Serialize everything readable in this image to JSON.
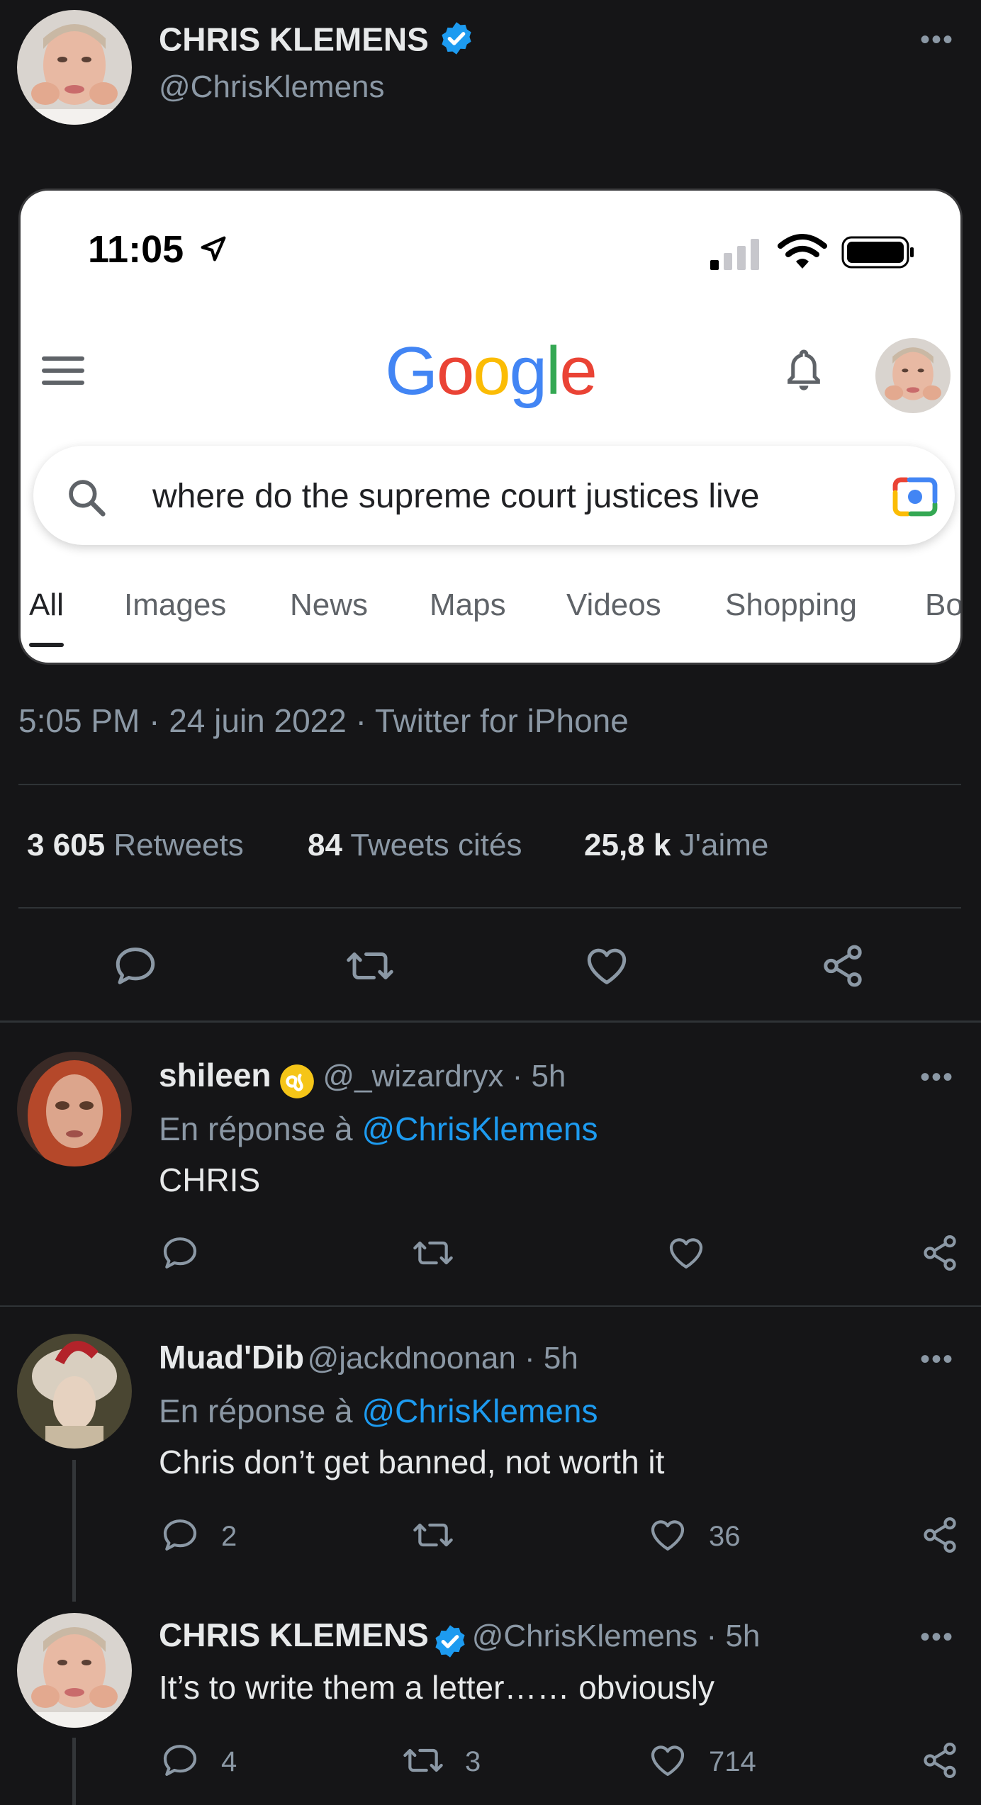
{
  "main_tweet": {
    "author_name": "CHRIS KLEMENS",
    "author_handle": "@ChrisKlemens",
    "timestamp_line": "5:05 PM · 24 juin 2022 · Twitter for iPhone",
    "stats": {
      "retweets_count": "3 605",
      "retweets_label": "Retweets",
      "quotes_count": "84",
      "quotes_label": "Tweets cités",
      "likes_count": "25,8 k",
      "likes_label": "J'aime"
    }
  },
  "embedded_screenshot": {
    "status_time": "11:05",
    "logo_text": [
      "G",
      "o",
      "o",
      "g",
      "l",
      "e"
    ],
    "search_query": "where do the supreme court justices live",
    "tabs": [
      "All",
      "Images",
      "News",
      "Maps",
      "Videos",
      "Shopping",
      "Bo"
    ],
    "active_tab": "All"
  },
  "replies": [
    {
      "author_name": "shileen",
      "handle_time": "@_wizardryx · 5h",
      "in_reply_prefix": "En réponse à",
      "in_reply_mention": "@ChrisKlemens",
      "text": "CHRIS",
      "reply_count": "",
      "retweet_count": "",
      "like_count": ""
    },
    {
      "author_name": "Muad'Dib",
      "handle_time": "@jackdnoonan · 5h",
      "in_reply_prefix": "En réponse à",
      "in_reply_mention": "@ChrisKlemens",
      "text": "Chris don’t get banned, not worth it",
      "reply_count": "2",
      "retweet_count": "",
      "like_count": "36"
    },
    {
      "author_name": "CHRIS KLEMENS",
      "handle_time": "@ChrisKlemens · 5h",
      "text": "It’s to write them a letter…… obviously",
      "reply_count": "4",
      "retweet_count": "3",
      "like_count": "714"
    }
  ],
  "icons": {
    "more": "more-dots-icon",
    "reply": "reply-icon",
    "retweet": "retweet-icon",
    "like": "heart-icon",
    "share": "share-icon",
    "verified": "verified-badge-icon",
    "zodiac": "leo-zodiac-icon"
  },
  "colors": {
    "background": "#151517",
    "text": "#e7e9ea",
    "muted": "#8b98a5",
    "accent": "#1d9bf0",
    "google_blue": "#4285F4",
    "google_red": "#EA4335",
    "google_yellow": "#FBBC05",
    "google_green": "#34A853"
  }
}
